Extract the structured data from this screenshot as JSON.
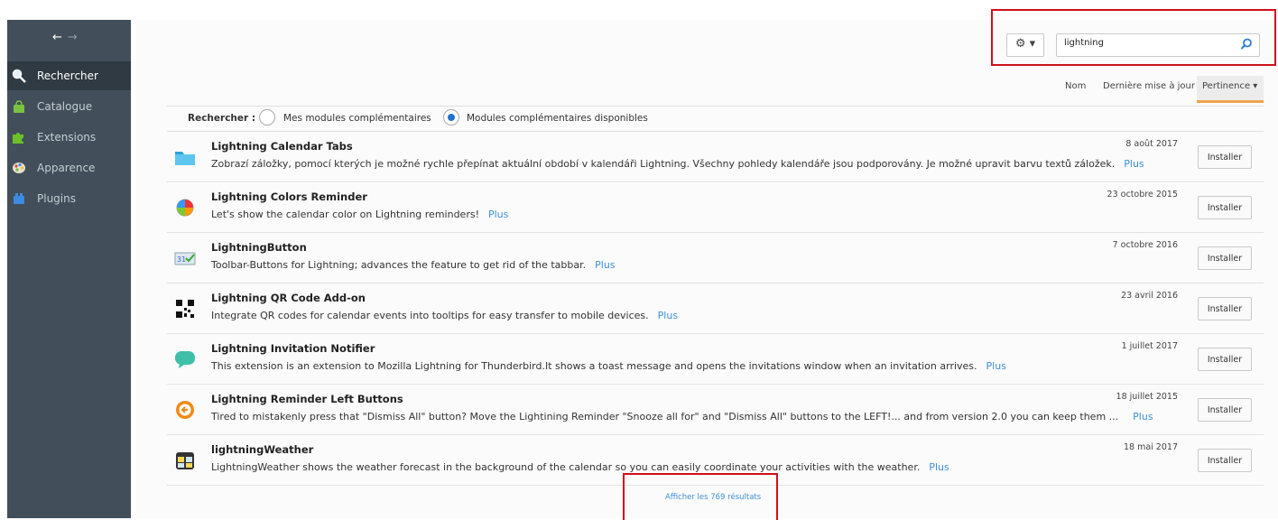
{
  "sidebar": {
    "items": [
      {
        "label": "Rechercher",
        "icon": "magnifier-icon"
      },
      {
        "label": "Catalogue",
        "icon": "shopping-bag-icon"
      },
      {
        "label": "Extensions",
        "icon": "puzzle-piece-icon"
      },
      {
        "label": "Apparence",
        "icon": "paint-palette-icon"
      },
      {
        "label": "Plugins",
        "icon": "lego-brick-icon"
      }
    ]
  },
  "toolbar": {
    "gear_label": "⚙ ▾",
    "search_value": "lightning"
  },
  "sort": {
    "name": "Nom",
    "updated": "Dernière mise à jour",
    "relevance": "Pertinence ▾"
  },
  "scope": {
    "label": "Rechercher :",
    "mine": "Mes modules complémentaires",
    "available": "Modules complémentaires disponibles"
  },
  "results": [
    {
      "name": "Lightning Calendar Tabs",
      "desc": "Zobrazí záložky, pomocí kterých je možné rychle přepínat aktuální období v kalendáři Lightning. Všechny pohledy kalendáře jsou podporovány. Je možné upravit barvu textů záložek.",
      "date": "8 août 2017",
      "plus": "Plus",
      "install": "Installer"
    },
    {
      "name": "Lightning Colors Reminder",
      "desc": "Let's show the calendar color on Lightning reminders!",
      "date": "23 octobre 2015",
      "plus": "Plus",
      "install": "Installer"
    },
    {
      "name": "LightningButton",
      "desc": "Toolbar-Buttons for Lightning; advances the feature to get rid of the tabbar.",
      "date": "7 octobre 2016",
      "plus": "Plus",
      "install": "Installer"
    },
    {
      "name": "Lightning QR Code Add-on",
      "desc": "Integrate QR codes for calendar events into tooltips for easy transfer to mobile devices.",
      "date": "23 avril 2016",
      "plus": "Plus",
      "install": "Installer"
    },
    {
      "name": "Lightning Invitation Notifier",
      "desc": "This extension is an extension to Mozilla Lightning for Thunderbird.It shows a toast message and opens the invitations window when an invitation arrives.",
      "date": "1 juillet 2017",
      "plus": "Plus",
      "install": "Installer"
    },
    {
      "name": "Lightning Reminder Left Buttons",
      "desc": "Tired to mistakenly press that \"Dismiss All\" button? Move the Lightining Reminder \"Snooze all for\" and \"Dismiss All\" buttons to the LEFT!... and from version 2.0 you can keep them ...",
      "date": "18 juillet 2015",
      "plus": "Plus",
      "install": "Installer"
    },
    {
      "name": "lightningWeather",
      "desc": "LightningWeather shows the weather forecast in the background of the calendar so you can easily coordinate your activities with the weather.",
      "date": "18 mai 2017",
      "plus": "Plus",
      "install": "Installer"
    }
  ],
  "show_all": "Afficher les 769 résultats"
}
